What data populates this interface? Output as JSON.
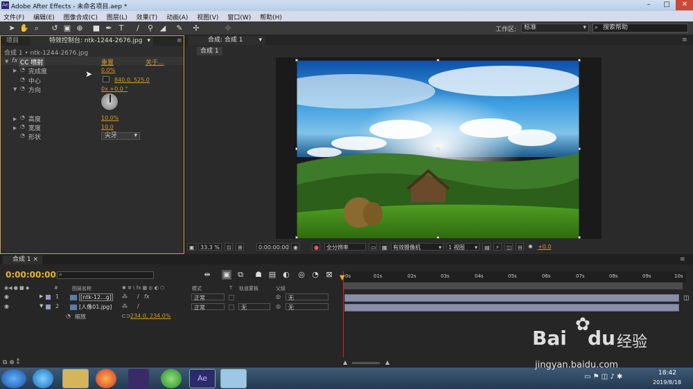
{
  "window": {
    "title": "Adobe After Effects - 未命名项目.aep *",
    "app_icon": "Ae"
  },
  "menu": [
    "文件(F)",
    "编辑(E)",
    "图像合成(C)",
    "图层(L)",
    "效果(T)",
    "动画(A)",
    "视图(V)",
    "窗口(W)",
    "帮助(H)"
  ],
  "toolbar": {
    "workspace_label": "工作区:",
    "workspace_value": "标准",
    "help_placeholder": "搜索帮助"
  },
  "left_panel": {
    "tabs": [
      "项目",
      "特效控制台: ntk-1244-2676.jpg"
    ],
    "breadcrumb": "合成 1 • ntk-1244-2676.jpg",
    "effect": {
      "fx": "fx",
      "name": "CC 喷射",
      "reset": "重置",
      "about": "关于..."
    },
    "props": [
      {
        "label": "完成度",
        "value": "0.0%"
      },
      {
        "label": "中心",
        "value": "840.0, 525.0"
      },
      {
        "label": "方向",
        "value": "0x +0.0 °"
      },
      {
        "label": "高度",
        "value": "10.0%"
      },
      {
        "label": "宽度",
        "value": "10.0"
      },
      {
        "label": "形状",
        "value": "尖牙"
      }
    ]
  },
  "comp_panel": {
    "tab": "合成: 合成 1",
    "subtab": "合成 1",
    "zoom": "33.3 %",
    "timecode": "0:00:00:00",
    "resolution": "全分辨率",
    "camera": "有效摄像机",
    "views": "1 视图",
    "exposure": "+0.0"
  },
  "timeline": {
    "tab": "合成 1",
    "time": "0:00:00:00",
    "headers": [
      "#",
      "图层名称",
      "模式",
      "T",
      "轨道蒙板",
      "父级"
    ],
    "ruler_ticks": [
      "0s",
      "01s",
      "02s",
      "03s",
      "04s",
      "05s",
      "06s",
      "07s",
      "08s",
      "09s",
      "10s"
    ],
    "layers": [
      {
        "num": "1",
        "name": "[ntk-12...g]",
        "mode": "正常",
        "trkmat": "",
        "parent": "无"
      },
      {
        "num": "2",
        "name": "[人像01.jpg]",
        "mode": "正常",
        "trkmat": "无",
        "parent": "无"
      }
    ],
    "sub_prop": {
      "label": "缩放",
      "value": "234.0, 234.0%"
    }
  },
  "taskbar": {
    "time": "18:42",
    "date": "2019/8/18"
  },
  "watermark": {
    "brand": "Bai",
    "brand2": "du",
    "suffix": "经验",
    "url": "jingyan.baidu.com"
  }
}
